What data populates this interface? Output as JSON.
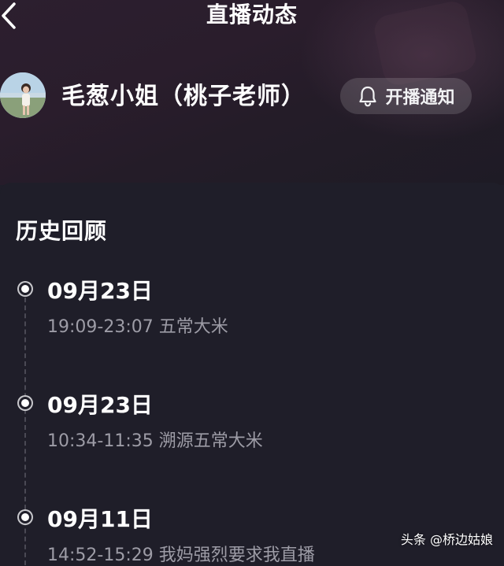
{
  "header": {
    "title": "直播动态",
    "back_icon": "chevron-left-icon"
  },
  "streamer": {
    "name": "毛葱小姐（桃子老师）",
    "notify_label": "开播通知",
    "notify_icon": "bell-icon"
  },
  "history": {
    "section_title": "历史回顾",
    "items": [
      {
        "date": "09月23日",
        "time_title": "19:09-23:07 五常大米"
      },
      {
        "date": "09月23日",
        "time_title": "10:34-11:35 溯源五常大米"
      },
      {
        "date": "09月11日",
        "time_title": "14:52-15:29 我妈强烈要求我直播"
      }
    ]
  },
  "watermark": {
    "text": "头条 @桥边姑娘"
  },
  "colors": {
    "background": "#1f1e29",
    "header_gradient": "#2c1f2f",
    "muted_text": "#9d9ca6",
    "button_bg": "rgba(255,255,255,0.14)"
  }
}
